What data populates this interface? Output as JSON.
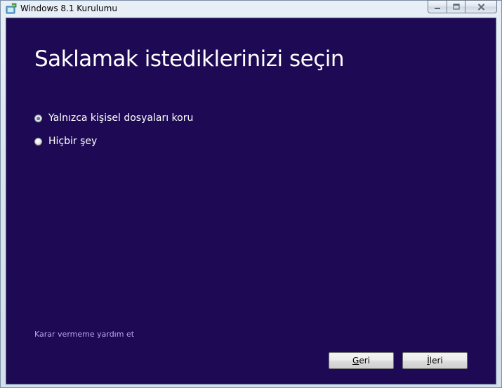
{
  "window": {
    "title": "Windows 8.1 Kurulumu"
  },
  "main": {
    "heading": "Saklamak istediklerinizi seçin",
    "options": [
      {
        "label": "Yalnızca kişisel dosyaları koru",
        "selected": true
      },
      {
        "label": "Hiçbir şey",
        "selected": false
      }
    ],
    "help_link": "Karar vermeme yardım et"
  },
  "buttons": {
    "back": {
      "accel": "G",
      "rest": "eri"
    },
    "next": {
      "accel": "İ",
      "rest": "leri"
    }
  },
  "colors": {
    "background": "#1e0a54",
    "link": "#b7a6f5",
    "text": "#ffffff"
  },
  "icons": {
    "app": "windows-setup-icon",
    "minimize": "minimize-icon",
    "maximize": "maximize-icon",
    "close": "close-icon"
  }
}
